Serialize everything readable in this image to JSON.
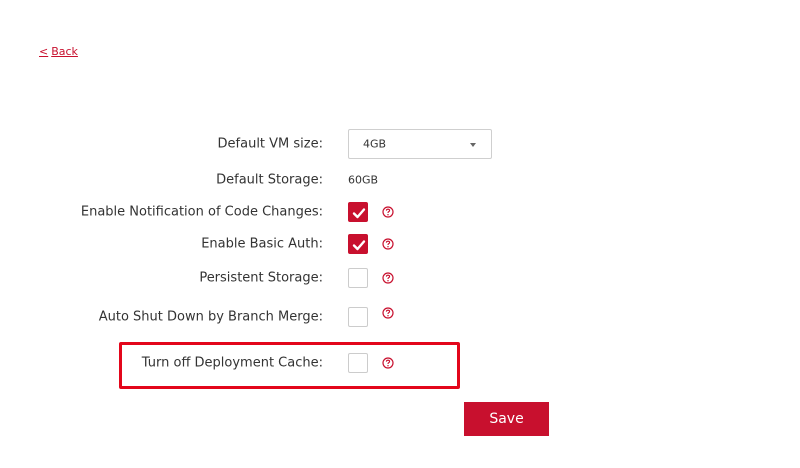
{
  "back_link": {
    "chevron": "<",
    "label": "Back"
  },
  "settings": {
    "vm_size": {
      "label": "Default VM size:",
      "value": "4GB"
    },
    "storage": {
      "label": "Default Storage:",
      "value": "60GB"
    },
    "notify_code_changes": {
      "label": "Enable Notification of Code Changes:",
      "checked": true
    },
    "basic_auth": {
      "label": "Enable Basic Auth:",
      "checked": true
    },
    "persistent_storage": {
      "label": "Persistent Storage:",
      "checked": false
    },
    "auto_shutdown": {
      "label": "Auto Shut Down by Branch Merge:",
      "checked": false
    },
    "deployment_cache": {
      "label": "Turn off Deployment Cache:",
      "checked": false
    }
  },
  "save_button": {
    "label": "Save"
  },
  "colors": {
    "accent": "#c8102e",
    "highlight_border": "#e3061b"
  },
  "icons": {
    "help": "question-circle-icon",
    "check": "checkmark-icon",
    "caret": "caret-down-icon"
  }
}
